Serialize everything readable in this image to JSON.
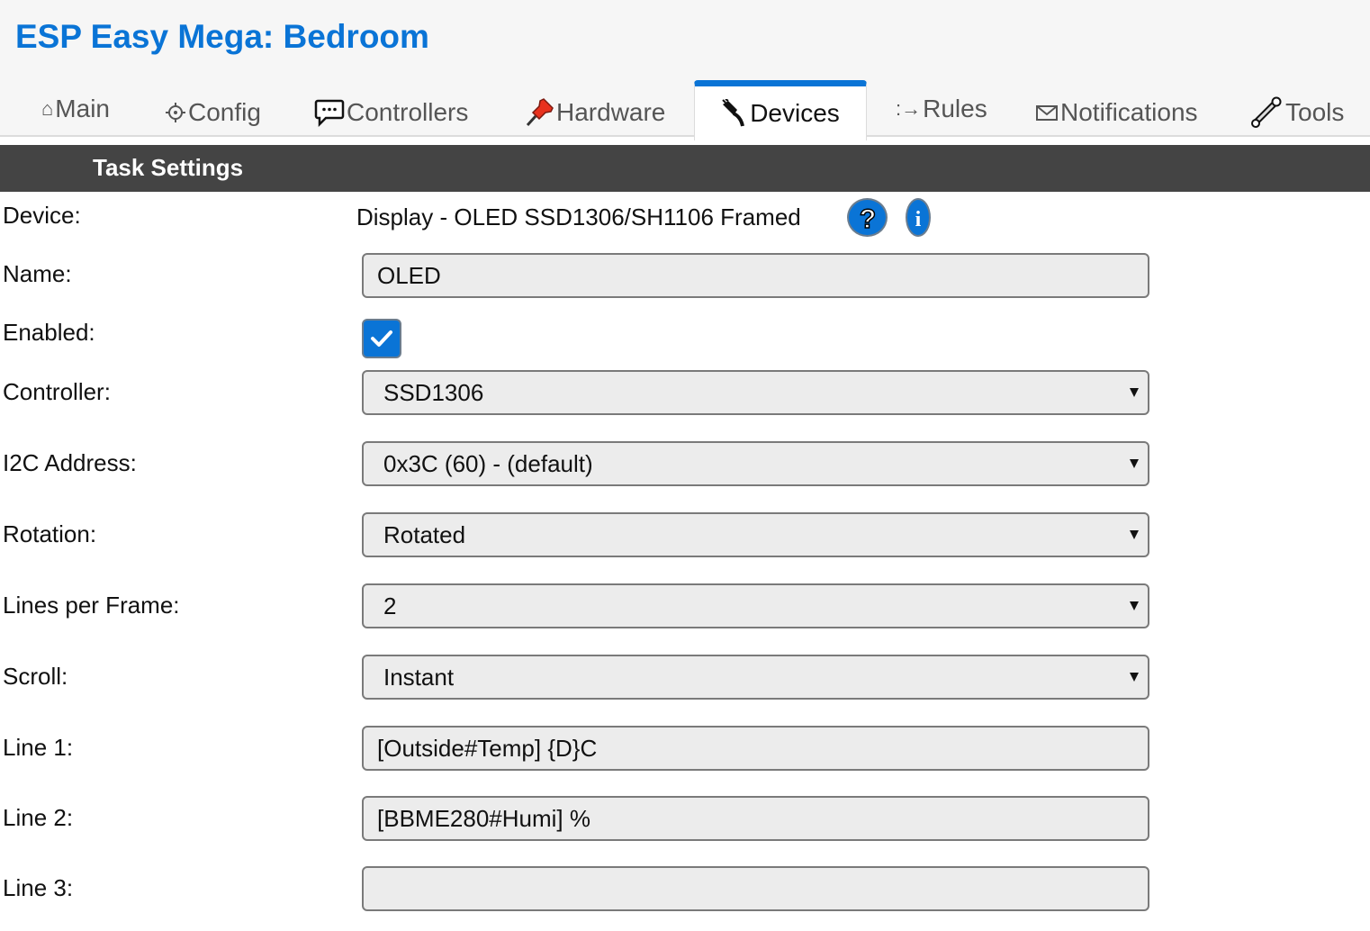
{
  "header": {
    "title": "ESP Easy Mega: Bedroom",
    "accent_color": "#0a74d6"
  },
  "tabs": [
    {
      "label": "Main",
      "icon": "home-icon",
      "glyph": "⌂",
      "active": false
    },
    {
      "label": "Config",
      "icon": "gear-icon",
      "glyph": "⚙",
      "active": false
    },
    {
      "label": "Controllers",
      "icon": "speech-bubble-icon",
      "active": false
    },
    {
      "label": "Hardware",
      "icon": "pushpin-icon",
      "active": false
    },
    {
      "label": "Devices",
      "icon": "plug-icon",
      "active": true
    },
    {
      "label": "Rules",
      "icon": "arrow-icon",
      "glyph": ":→",
      "active": false
    },
    {
      "label": "Notifications",
      "icon": "envelope-icon",
      "active": false
    },
    {
      "label": "Tools",
      "icon": "wrench-icon",
      "active": false
    }
  ],
  "section": {
    "title": "Task Settings"
  },
  "form": {
    "device": {
      "label": "Device:",
      "value": "Display - OLED SSD1306/SH1106 Framed",
      "help_icon": "question-icon",
      "info_icon": "info-icon"
    },
    "name": {
      "label": "Name:",
      "value": "OLED",
      "placeholder": ""
    },
    "enabled": {
      "label": "Enabled:",
      "checked": true
    },
    "controller": {
      "label": "Controller:",
      "value": "SSD1306"
    },
    "i2c_address": {
      "label": "I2C Address:",
      "value": "0x3C (60) - (default)"
    },
    "rotation": {
      "label": "Rotation:",
      "value": "Rotated"
    },
    "lines_per_frame": {
      "label": "Lines per Frame:",
      "value": "2"
    },
    "scroll": {
      "label": "Scroll:",
      "value": "Instant"
    },
    "line1": {
      "label": "Line 1:",
      "value": "[Outside#Temp] {D}C"
    },
    "line2": {
      "label": "Line 2:",
      "value": "[BBME280#Humi] %"
    },
    "line3": {
      "label": "Line 3:",
      "value": ""
    }
  }
}
